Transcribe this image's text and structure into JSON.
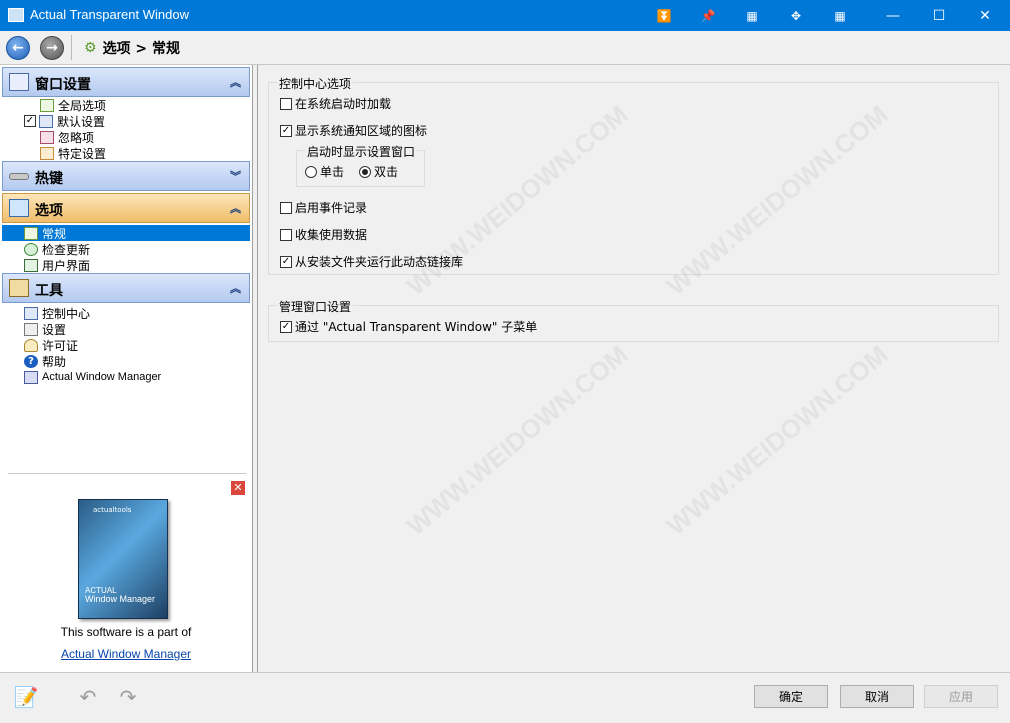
{
  "window": {
    "title": "Actual Transparent Window"
  },
  "breadcrumb": {
    "text": "选项 > 常规"
  },
  "sidebar": {
    "sections": [
      {
        "label": "窗口设置",
        "items": [
          "全局选项",
          "默认设置",
          "忽略项",
          "特定设置"
        ]
      },
      {
        "label": "热键",
        "items": []
      },
      {
        "label": "选项",
        "items": [
          "常规",
          "检查更新",
          "用户界面"
        ]
      },
      {
        "label": "工具",
        "items": [
          "控制中心",
          "设置",
          "许可证",
          "帮助",
          "Actual Window Manager"
        ]
      }
    ],
    "selected_item": "常规",
    "promo": {
      "product_name": "Window Manager",
      "product_brand": "ACTUAL",
      "logo_text": "actualtools",
      "text": "This software is a part of",
      "link": "Actual Window Manager"
    }
  },
  "main": {
    "group1": {
      "title": "控制中心选项",
      "opt_startup": "在系统启动时加载",
      "opt_tray": "显示系统通知区域的图标",
      "subgroup": {
        "title": "启动时显示设置窗口",
        "radio_single": "单击",
        "radio_double": "双击"
      },
      "opt_log": "启用事件记录",
      "opt_usage": "收集使用数据",
      "opt_dll": "从安装文件夹运行此动态链接库"
    },
    "group2": {
      "title": "管理窗口设置",
      "opt_submenu": "通过 \"Actual Transparent Window\" 子菜单"
    }
  },
  "footer": {
    "ok": "确定",
    "cancel": "取消",
    "apply": "应用"
  },
  "watermark": "WWW.WEIDOWN.COM"
}
